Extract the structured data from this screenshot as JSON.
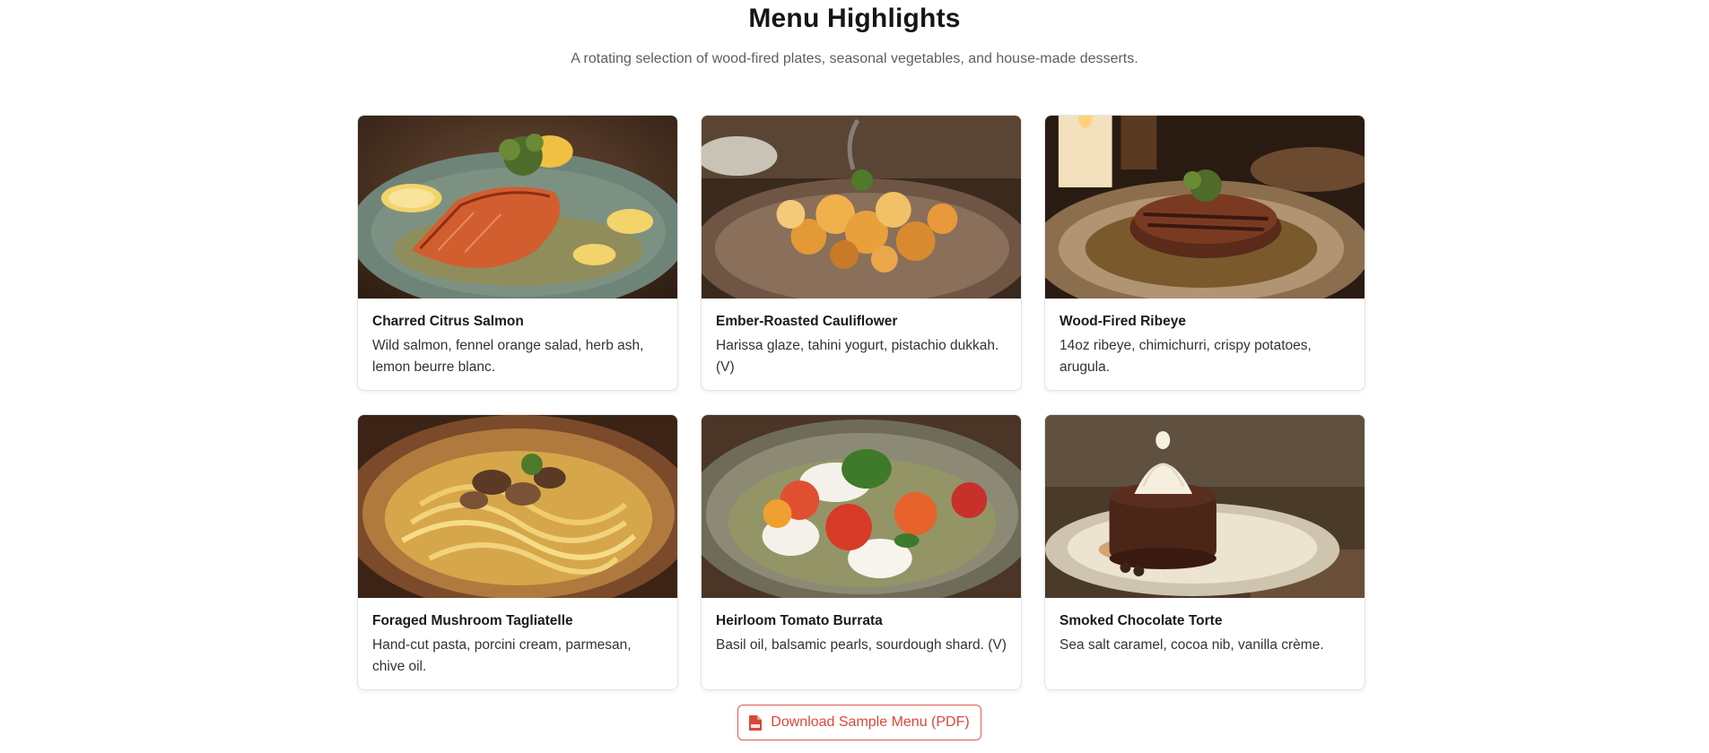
{
  "header": {
    "title": "Menu Highlights",
    "subtitle": "A rotating selection of wood-fired plates, seasonal vegetables, and house-made desserts."
  },
  "menu_items": [
    {
      "name": "Charred Citrus Salmon",
      "description": "Wild salmon, fennel orange salad, herb ash, lemon beurre blanc.",
      "photo": "salmon-photo"
    },
    {
      "name": "Ember-Roasted Cauliflower",
      "description": "Harissa glaze, tahini yogurt, pistachio dukkah. (V)",
      "photo": "cauliflower-photo"
    },
    {
      "name": "Wood-Fired Ribeye",
      "description": "14oz ribeye, chimichurri, crispy potatoes, arugula.",
      "photo": "ribeye-photo"
    },
    {
      "name": "Foraged Mushroom Tagliatelle",
      "description": "Hand-cut pasta, porcini cream, parmesan, chive oil.",
      "photo": "tagliatelle-photo"
    },
    {
      "name": "Heirloom Tomato Burrata",
      "description": "Basil oil, balsamic pearls, sourdough shard. (V)",
      "photo": "burrata-photo"
    },
    {
      "name": "Smoked Chocolate Torte",
      "description": "Sea salt caramel, cocoa nib, vanilla crème.",
      "photo": "torte-photo"
    }
  ],
  "download": {
    "label": "Download Sample Menu (PDF)",
    "icon": "pdf-file-icon",
    "accent_color": "#d9473a"
  }
}
